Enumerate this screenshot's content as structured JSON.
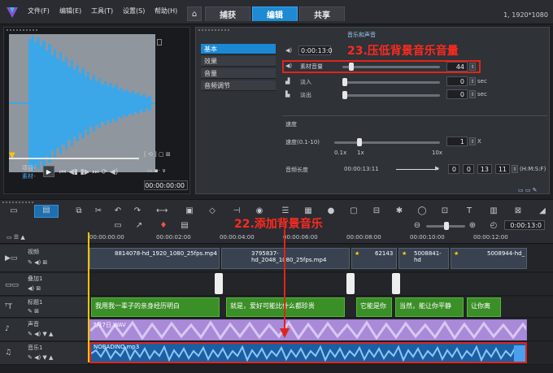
{
  "menu": [
    "文件(F)",
    "编辑(E)",
    "工具(T)",
    "设置(S)",
    "帮助(H)"
  ],
  "tabs": [
    "捕获",
    "编辑",
    "共享"
  ],
  "resolution": "1, 1920*1080",
  "preview": {
    "project_label": "项目-",
    "clip_label": "素材-",
    "timecode": "00:00:00:00"
  },
  "panel": {
    "header": "音乐和声音",
    "categories": [
      "基本",
      "效果",
      "音量",
      "音频调节"
    ],
    "duration": "0:00:13:0",
    "clip_volume_label": "素材音量",
    "clip_volume_value": "44",
    "fade_in_label": "淡入",
    "fade_in_value": "0",
    "fade_out_label": "淡出",
    "fade_out_value": "0",
    "sec": "sec",
    "speed_section": "速度",
    "speed_label": "速度(0.1-10)",
    "speed_value": "1",
    "speed_unit": "X",
    "speed_ticks": [
      "0.1x",
      "1x",
      "10x"
    ],
    "audio_length_label": "音频长度",
    "audio_length_value": "00:00:13:11",
    "length_boxes": [
      "0",
      "0",
      "13",
      "11"
    ],
    "length_format": "(H:M:S:F)"
  },
  "annotations": {
    "step23": "23.压低背景音乐音量",
    "step22": "22.添加背景音乐"
  },
  "timeline": {
    "ruler": [
      "00:00:00:00",
      "00:00:02:00",
      "00:00:04:00",
      "00:00:06:00",
      "00:00:08:00",
      "00:00:10:00",
      "00:00:12:00"
    ],
    "zoom_timecode": "0:00:13:0",
    "tracks": [
      "视频",
      "叠加1",
      "标题1",
      "声音",
      "音乐1"
    ],
    "video_clips": [
      "8814078-hd_1920_1080_25fps.mp4",
      "3795837-hd_2048_1080_25fps.mp4",
      "62143",
      "5008841-hd",
      "5008944-hd_"
    ],
    "title_clips": [
      "我用我一辈子的亲身经历明白",
      "就是，爱好可能比什么都珍贵",
      "它能是你",
      "当然，能让你平静",
      "让你离"
    ],
    "voice_clip": "7月7日.WAV",
    "music_clip": "NOBADINO.mp3"
  },
  "colors": {
    "accent": "#1d8ad3",
    "annotation": "#e0241c"
  }
}
